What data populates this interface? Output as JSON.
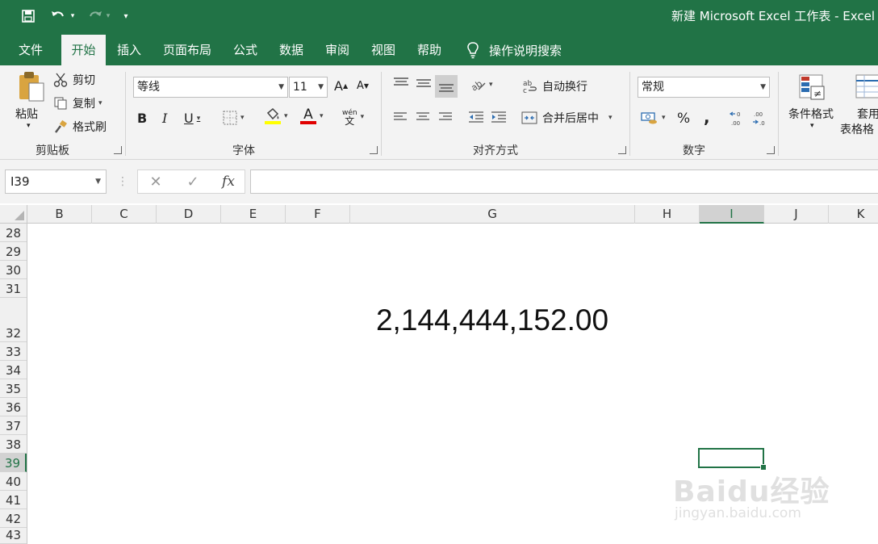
{
  "titlebar": {
    "title": "新建 Microsoft Excel 工作表  -  Excel",
    "save_icon": "save-icon",
    "undo_icon": "undo-icon",
    "redo_icon": "redo-icon",
    "customize_icon": "customize-quick-access-icon"
  },
  "tabs": [
    {
      "label": "文件"
    },
    {
      "label": "开始"
    },
    {
      "label": "插入"
    },
    {
      "label": "页面布局"
    },
    {
      "label": "公式"
    },
    {
      "label": "数据"
    },
    {
      "label": "审阅"
    },
    {
      "label": "视图"
    },
    {
      "label": "帮助"
    }
  ],
  "tab_hint": "操作说明搜索",
  "ribbon": {
    "clipboard": {
      "paste": "粘贴",
      "cut": "剪切",
      "copy": "复制",
      "format_painter": "格式刷",
      "label": "剪贴板"
    },
    "font": {
      "font_name": "等线",
      "font_size": "11",
      "bold": "B",
      "italic": "I",
      "underline": "U",
      "phonetic": "wén",
      "label": "字体",
      "fill_color": "#ffff00",
      "font_color": "#e00000"
    },
    "alignment": {
      "wrap_text": "自动换行",
      "merge_center": "合并后居中",
      "label": "对齐方式"
    },
    "number": {
      "format": "常规",
      "percent": "%",
      "comma": ",",
      "label": "数字"
    },
    "styles": {
      "conditional": "条件格式",
      "table_line1": "套用",
      "table_line2": "表格格"
    }
  },
  "formula_bar": {
    "name_box": "I39",
    "cancel": "✕",
    "enter": "✓",
    "fx": "fx",
    "value": ""
  },
  "columns": [
    "B",
    "C",
    "D",
    "E",
    "F",
    "G",
    "H",
    "I",
    "J",
    "K"
  ],
  "rows": [
    "28",
    "29",
    "30",
    "31",
    "32",
    "33",
    "34",
    "35",
    "36",
    "37",
    "38",
    "39",
    "40",
    "41",
    "42",
    "43"
  ],
  "selected_column": "I",
  "selected_row": "39",
  "cell_G32": "2,144,444,152.00",
  "watermark": {
    "logo": "Baidu经验",
    "url": "jingyan.baidu.com"
  }
}
